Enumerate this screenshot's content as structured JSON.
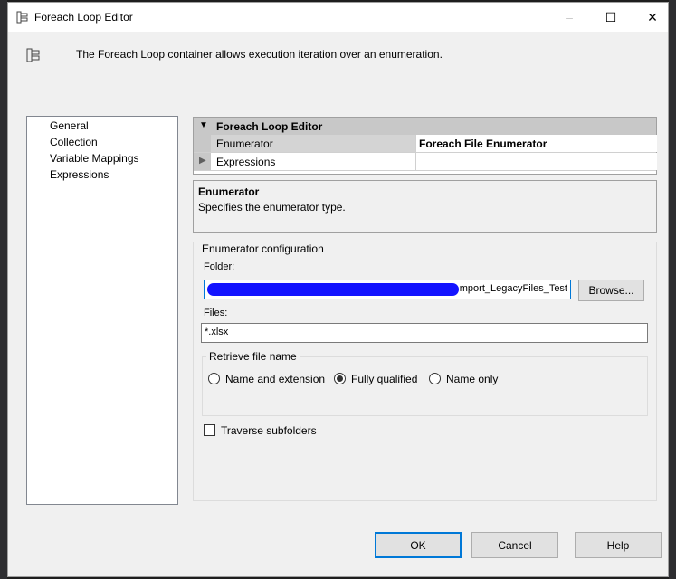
{
  "window": {
    "title": "Foreach Loop Editor",
    "minimize_glyph": "–",
    "maximize_glyph": "☐",
    "close_glyph": "✕"
  },
  "description": "The Foreach Loop container allows execution iteration over an enumeration.",
  "nav": {
    "items": [
      {
        "label": "General"
      },
      {
        "label": "Collection"
      },
      {
        "label": "Variable Mappings"
      },
      {
        "label": "Expressions"
      }
    ],
    "selected": "Collection"
  },
  "property_grid": {
    "category": "Foreach Loop Editor",
    "rows": [
      {
        "name": "Enumerator",
        "value": "Foreach File Enumerator"
      },
      {
        "name": "Expressions",
        "value": ""
      }
    ]
  },
  "help": {
    "title": "Enumerator",
    "description": "Specifies the enumerator type."
  },
  "config": {
    "group_label": "Enumerator configuration",
    "folder_label": "Folder:",
    "folder_value": "mport_LegacyFiles_Test",
    "browse_label": "Browse...",
    "files_label": "Files:",
    "files_value": "*.xlsx",
    "retrieve_label": "Retrieve file name",
    "options": [
      {
        "label": "Name and extension",
        "selected": false
      },
      {
        "label": "Fully qualified",
        "selected": true
      },
      {
        "label": "Name only",
        "selected": false
      }
    ],
    "traverse_label": "Traverse subfolders",
    "traverse_checked": false
  },
  "buttons": {
    "ok": "OK",
    "cancel": "Cancel",
    "help": "Help"
  },
  "colors": {
    "focus_border": "#0078d7",
    "redaction": "#1414ff"
  }
}
